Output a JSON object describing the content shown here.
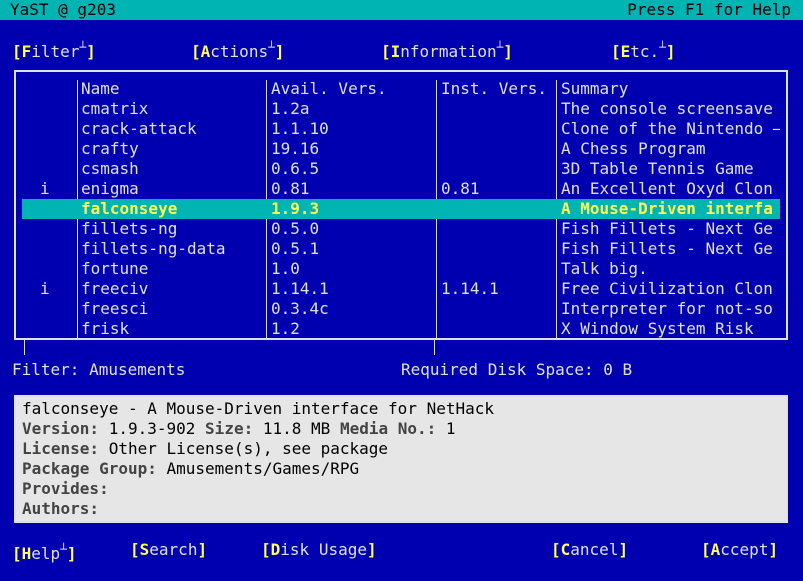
{
  "title": {
    "left": "YaST @ g203",
    "right": "Press F1 for Help"
  },
  "menu": [
    {
      "key": "F",
      "rest": "ilter",
      "name": "menu-filter"
    },
    {
      "key": "A",
      "rest": "ctions",
      "name": "menu-actions"
    },
    {
      "key": "I",
      "rest": "nformation",
      "name": "menu-information"
    },
    {
      "key": "E",
      "rest": "tc.",
      "name": "menu-etc"
    }
  ],
  "table": {
    "headers": {
      "status": "",
      "name": "Name",
      "avail": "Avail. Vers.",
      "inst": "Inst. Vers.",
      "summary": "Summary"
    },
    "rows": [
      {
        "status": "",
        "name": "cmatrix",
        "avail": "1.2a",
        "inst": "",
        "summary": "The console screensave"
      },
      {
        "status": "",
        "name": "crack-attack",
        "avail": "1.1.10",
        "inst": "",
        "summary": "Clone of the Nintendo –"
      },
      {
        "status": "",
        "name": "crafty",
        "avail": "19.16",
        "inst": "",
        "summary": "A Chess Program"
      },
      {
        "status": "",
        "name": "csmash",
        "avail": "0.6.5",
        "inst": "",
        "summary": "3D Table Tennis Game"
      },
      {
        "status": "i",
        "name": "enigma",
        "avail": "0.81",
        "inst": "0.81",
        "summary": "An Excellent Oxyd Clon"
      },
      {
        "status": "",
        "name": "falconseye",
        "avail": "1.9.3",
        "inst": "",
        "summary": "A Mouse-Driven interfa",
        "selected": true
      },
      {
        "status": "",
        "name": "fillets-ng",
        "avail": "0.5.0",
        "inst": "",
        "summary": "Fish Fillets - Next Ge"
      },
      {
        "status": "",
        "name": "fillets-ng-data",
        "avail": "0.5.1",
        "inst": "",
        "summary": "Fish Fillets - Next Ge"
      },
      {
        "status": "",
        "name": "fortune",
        "avail": "1.0",
        "inst": "",
        "summary": "Talk big."
      },
      {
        "status": "i",
        "name": "freeciv",
        "avail": "1.14.1",
        "inst": "1.14.1",
        "summary": "Free Civilization Clon"
      },
      {
        "status": "",
        "name": "freesci",
        "avail": "0.3.4c",
        "inst": "",
        "summary": "Interpreter for not-so"
      },
      {
        "status": "",
        "name": "frisk",
        "avail": "1.2",
        "inst": "",
        "summary": "X Window System Risk"
      }
    ]
  },
  "status": {
    "filter": "Filter: Amusements",
    "disk": "Required Disk Space: 0 B"
  },
  "info": {
    "heading": "falconseye - A Mouse-Driven interface for NetHack",
    "version_label": "Version:",
    "version": "1.9.3-902",
    "size_label": "Size:",
    "size": "11.8 MB",
    "media_label": "Media No.:",
    "media": "1",
    "license_label": "License:",
    "license": "Other License(s), see package",
    "group_label": "Package Group:",
    "group": "Amusements/Games/RPG",
    "provides_label": "Provides:",
    "provides": "",
    "authors_label": "Authors:",
    "authors": ""
  },
  "buttons": [
    {
      "key": "H",
      "rest": "elp",
      "name": "help-button",
      "sup": true
    },
    {
      "key": "S",
      "rest": "earch",
      "name": "search-button"
    },
    {
      "key": "D",
      "rest": "isk Usage",
      "name": "disk-usage-button"
    },
    {
      "key": "C",
      "rest": "ancel",
      "name": "cancel-button"
    },
    {
      "key": "A",
      "rest": "ccept",
      "name": "accept-button"
    }
  ],
  "colors": {
    "background": "#0000b0",
    "highlight": "#00b4b4",
    "hotkey": "#ffff55",
    "infobox": "#e6e6e6"
  }
}
